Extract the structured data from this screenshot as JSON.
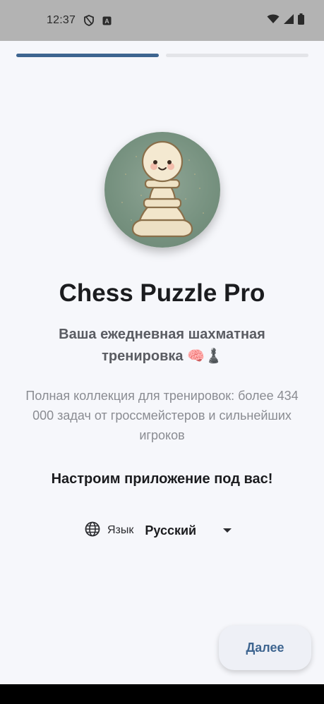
{
  "status_bar": {
    "time": "12:37",
    "left_icons": [
      "shield-icon",
      "a-icon"
    ],
    "right_icons": [
      "wifi-icon",
      "signal-icon",
      "battery-icon"
    ]
  },
  "progress": {
    "current_step": 1,
    "total_steps": 2
  },
  "logo": {
    "icon": "chess-pawn-icon"
  },
  "app_title": "Chess Puzzle Pro",
  "subtitle": "Ваша ежедневная шахматная тренировка 🧠♟️",
  "description": "Полная коллекция для тренировок: более 434 000 задач от гроссмейстеров и сильнейших игроков",
  "setup_heading": "Настроим приложение под вас!",
  "language": {
    "icon": "globe-icon",
    "label": "Язык",
    "value": "Русский"
  },
  "next_button": {
    "label": "Далее"
  },
  "colors": {
    "accent": "#3e6590",
    "background": "#f6f7fb",
    "status_bar": "#b3b3b3"
  }
}
